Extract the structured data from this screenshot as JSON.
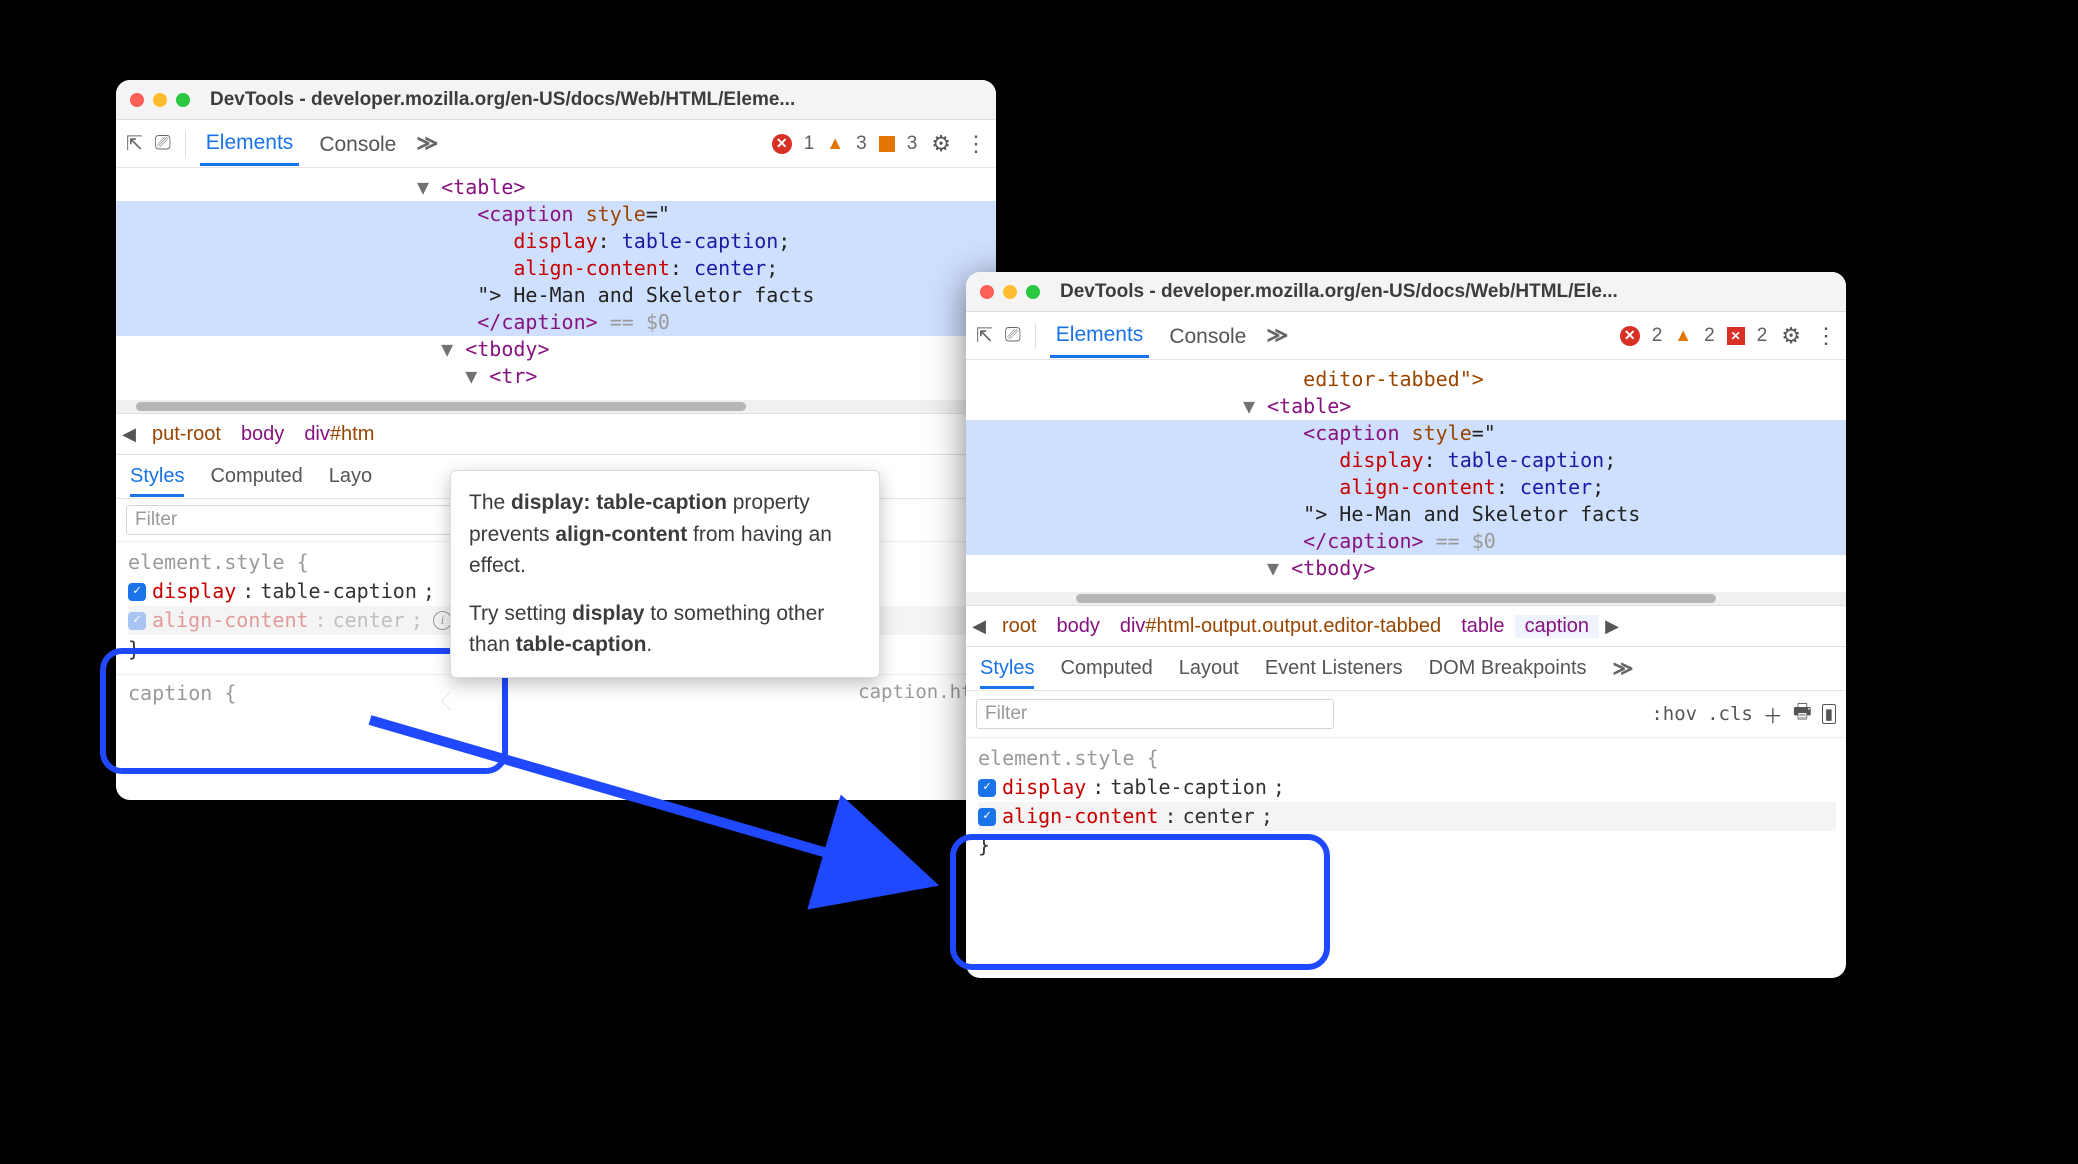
{
  "left": {
    "title": "DevTools - developer.mozilla.org/en-US/docs/Web/HTML/Eleme...",
    "tabs": {
      "elements": "Elements",
      "console": "Console"
    },
    "counts": {
      "errors": 1,
      "warnings": 3,
      "flags": 3
    },
    "dom": {
      "table_open": "<table>",
      "caption_open": "<caption ",
      "style_attr": "style",
      "eq_quote": "=\"",
      "p1_name": "display",
      "p1_sep": ": ",
      "p1_val": "table-caption",
      "p1_semi": ";",
      "p2_name": "align-content",
      "p2_sep": ": ",
      "p2_val": "center",
      "p2_semi": ";",
      "close_quote": "\">",
      "text": " He-Man and Skeletor facts",
      "caption_close": "</caption>",
      "eqsel": " == ",
      "dollar0": "$0",
      "tbody_open": "<tbody>",
      "tr_open": "<tr>"
    },
    "crumbs": {
      "root": "put-root",
      "body": "body",
      "div": "div",
      "divrest": "#htm"
    },
    "subtabs": {
      "styles": "Styles",
      "computed": "Computed",
      "layout": "Layo"
    },
    "filter_placeholder": "Filter",
    "style": {
      "selector": "element.style {",
      "p1n": "display",
      "p1v": "table-caption",
      "p2n": "align-content",
      "p2v": "center",
      "close": "}"
    },
    "below_sel": "caption {",
    "below_src": "caption.htm"
  },
  "right": {
    "title": "DevTools - developer.mozilla.org/en-US/docs/Web/HTML/Ele...",
    "tabs": {
      "elements": "Elements",
      "console": "Console"
    },
    "counts": {
      "errors": 2,
      "warnings": 2,
      "infos": 2
    },
    "dom": {
      "editor_tabbed": "editor-tabbed\">",
      "table_open": "<table>",
      "caption_open": "<caption ",
      "style_attr": "style",
      "eq_quote": "=\"",
      "p1_name": "display",
      "p1_sep": ": ",
      "p1_val": "table-caption",
      "p1_semi": ";",
      "p2_name": "align-content",
      "p2_sep": ": ",
      "p2_val": "center",
      "p2_semi": ";",
      "close_quote": "\">",
      "text": " He-Man and Skeletor facts",
      "caption_close": "</caption>",
      "eqsel": " == ",
      "dollar0": "$0",
      "tbody_open": "<tbody>"
    },
    "crumbs": {
      "root": "root",
      "body": "body",
      "div": "div",
      "divrest": "#html-output.output.editor-tabbed",
      "table": "table",
      "caption": "caption"
    },
    "subtabs": {
      "styles": "Styles",
      "computed": "Computed",
      "layout": "Layout",
      "events": "Event Listeners",
      "dom": "DOM Breakpoints"
    },
    "filter_placeholder": "Filter",
    "fr": {
      "hov": ":hov",
      "cls": ".cls"
    },
    "style": {
      "selector": "element.style {",
      "p1n": "display",
      "p1v": "table-caption",
      "p2n": "align-content",
      "p2v": "center",
      "close": "}"
    }
  },
  "tooltip": {
    "l1a": "The ",
    "l1b": "display: table-caption",
    "l1c": " property prevents ",
    "l1d": "align-content",
    "l1e": " from having an effect.",
    "l2a": "Try setting ",
    "l2b": "display",
    "l2c": " to something other than ",
    "l2d": "table-caption",
    "l2e": "."
  },
  "colors": {
    "blue": "#1f48ff"
  }
}
